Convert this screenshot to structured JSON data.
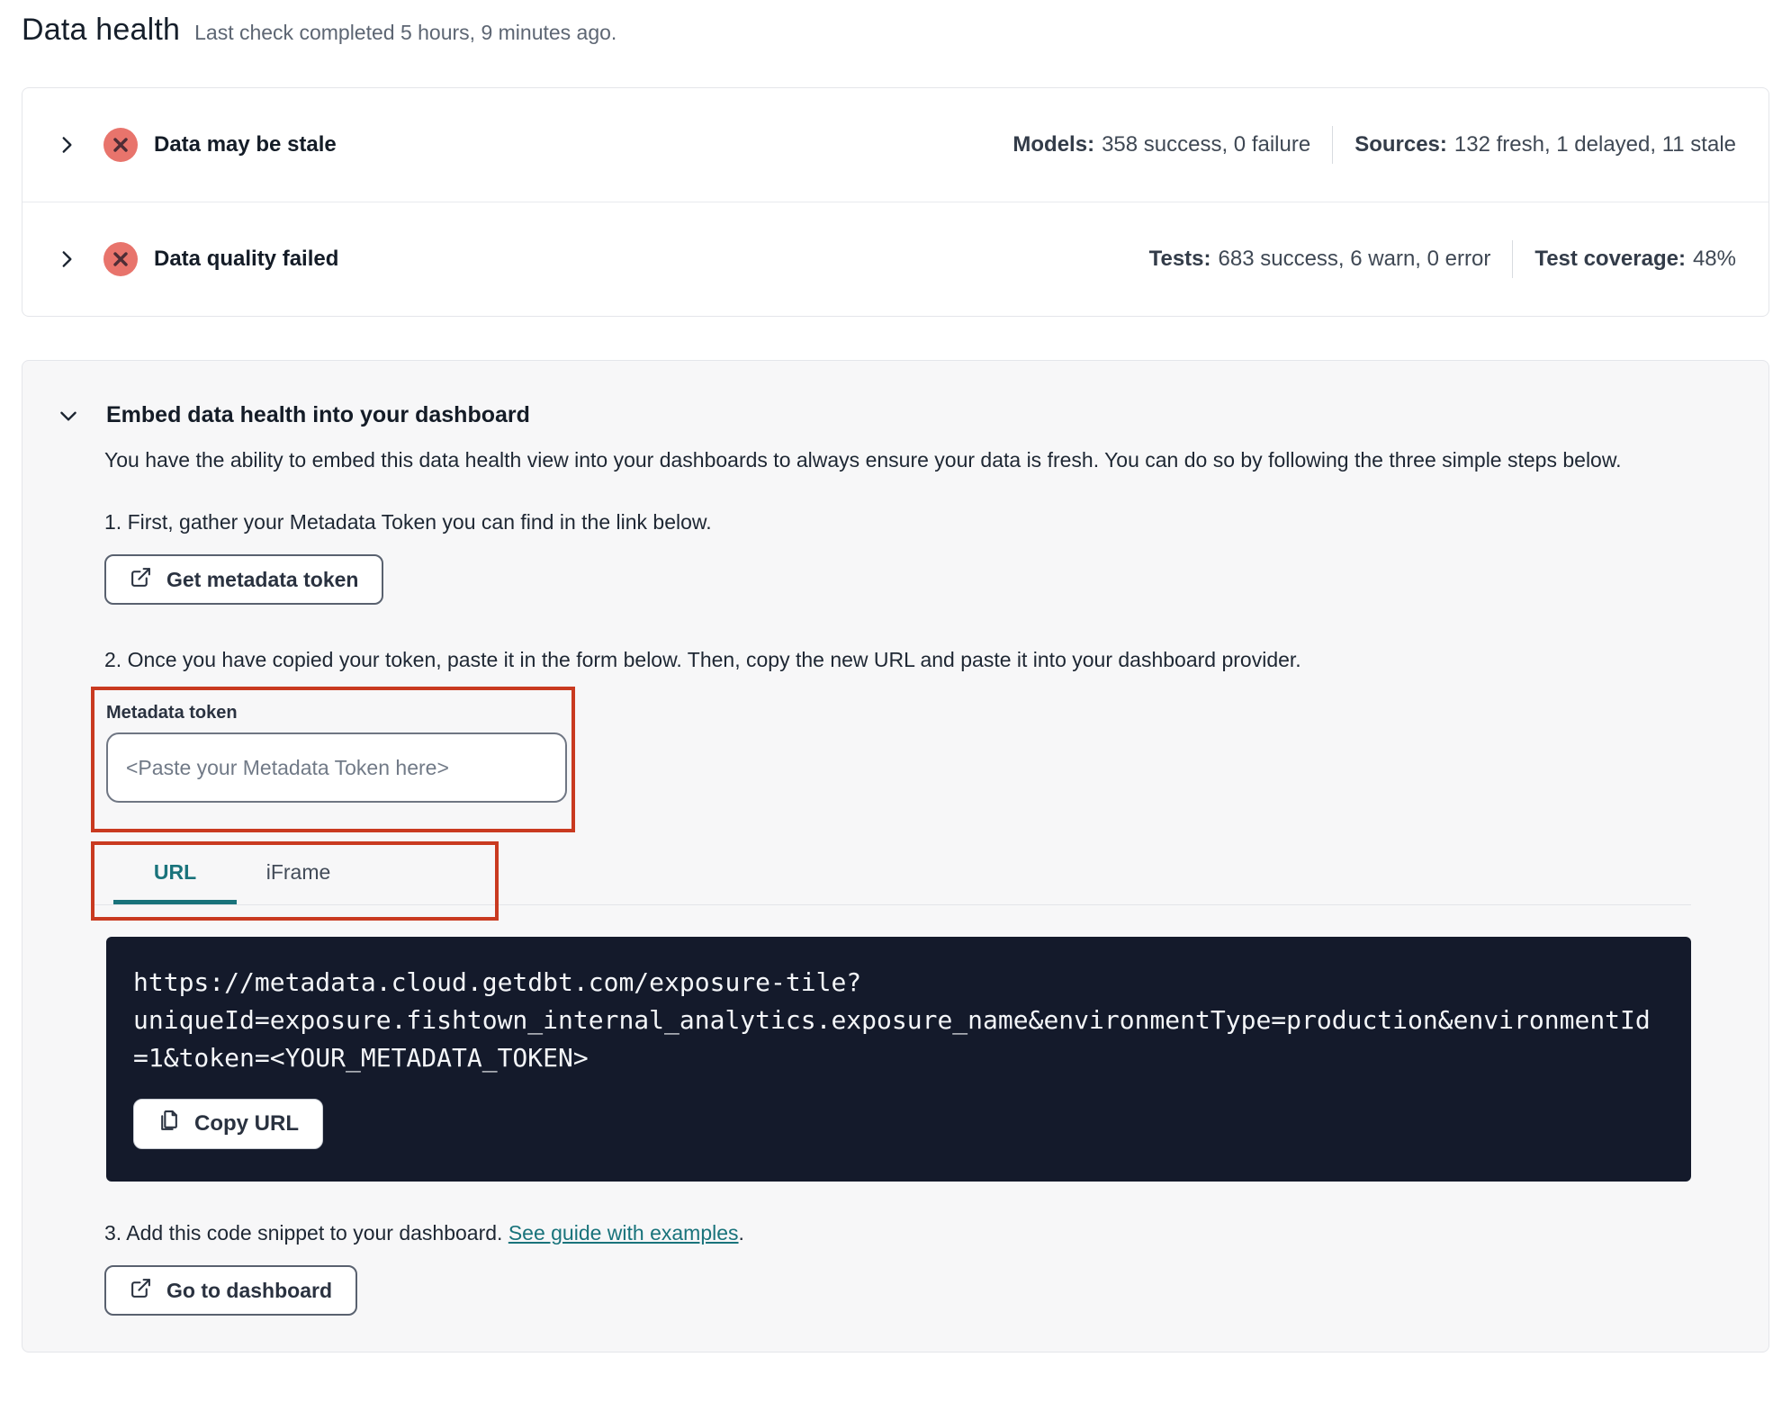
{
  "header": {
    "title": "Data health",
    "subtitle": "Last check completed 5 hours, 9 minutes ago."
  },
  "status_rows": [
    {
      "label": "Data may be stale",
      "stats": [
        {
          "label": "Models:",
          "value": "358 success, 0 failure"
        },
        {
          "label": "Sources:",
          "value": "132 fresh, 1 delayed, 11 stale"
        }
      ]
    },
    {
      "label": "Data quality failed",
      "stats": [
        {
          "label": "Tests:",
          "value": "683 success, 6 warn, 0 error"
        },
        {
          "label": "Test coverage:",
          "value": "48%"
        }
      ]
    }
  ],
  "embed": {
    "title": "Embed data health into your dashboard",
    "description": "You have the ability to embed this data health view into your dashboards to always ensure your data is fresh. You can do so by following the three simple steps below.",
    "step1": {
      "text": "1. First, gather your Metadata Token you can find in the link below.",
      "button": "Get metadata token"
    },
    "step2": {
      "text": "2. Once you have copied your token, paste it in the form below. Then, copy the new URL and paste it into your dashboard provider.",
      "token_label": "Metadata token",
      "token_placeholder": "<Paste your Metadata Token here>",
      "tabs": [
        {
          "label": "URL"
        },
        {
          "label": "iFrame"
        }
      ],
      "code_url": "https://metadata.cloud.getdbt.com/exposure-tile?uniqueId=exposure.fishtown_internal_analytics.exposure_name&environmentType=production&environmentId=1&token=<YOUR_METADATA_TOKEN>",
      "code_lines": [
        "https://metadata.cloud.getdbt.com/exposure-tile?",
        "uniqueId=exposure.fishtown_internal_analytics.exposure_name&environmentType=production&environmentId",
        "=1&token=<YOUR_METADATA_TOKEN>"
      ],
      "copy_button": "Copy URL"
    },
    "step3": {
      "text_before": "3. Add this code snippet to your dashboard. ",
      "link": "See guide with examples",
      "text_after": ".",
      "button": "Go to dashboard"
    }
  },
  "colors": {
    "red_highlight": "#C93A20",
    "teal_accent": "#19737B",
    "code_background": "#141A2B",
    "error_icon_fill": "#E8746C",
    "error_icon_cross": "#4E2D36"
  }
}
